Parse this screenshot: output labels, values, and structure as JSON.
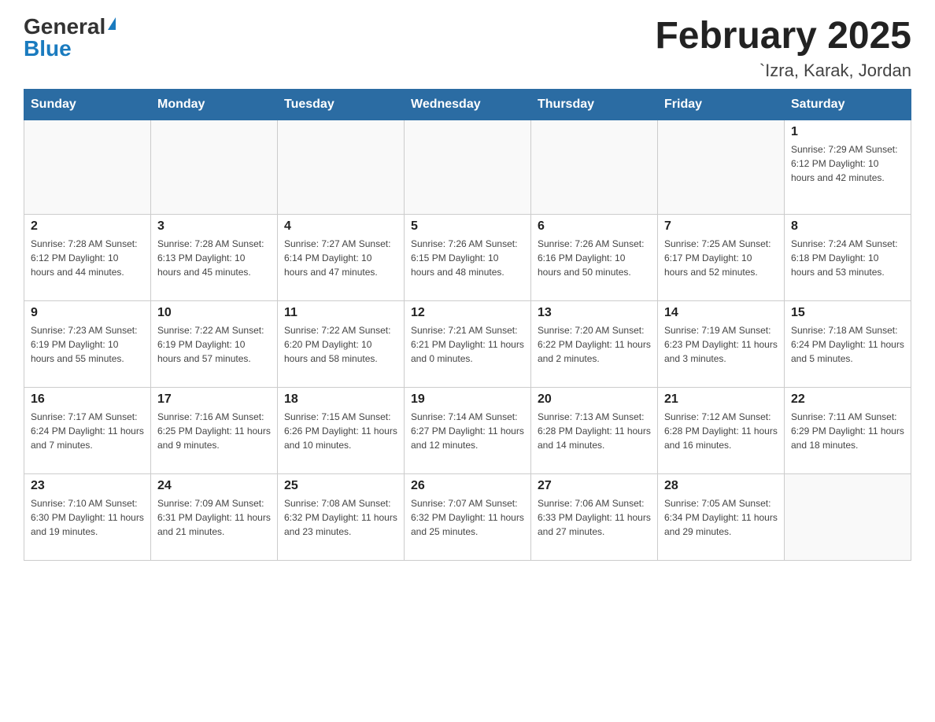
{
  "header": {
    "logo_general": "General",
    "logo_blue": "Blue",
    "month_title": "February 2025",
    "location": "`Izra, Karak, Jordan"
  },
  "days_of_week": [
    "Sunday",
    "Monday",
    "Tuesday",
    "Wednesday",
    "Thursday",
    "Friday",
    "Saturday"
  ],
  "weeks": [
    [
      {
        "day": "",
        "info": ""
      },
      {
        "day": "",
        "info": ""
      },
      {
        "day": "",
        "info": ""
      },
      {
        "day": "",
        "info": ""
      },
      {
        "day": "",
        "info": ""
      },
      {
        "day": "",
        "info": ""
      },
      {
        "day": "1",
        "info": "Sunrise: 7:29 AM\nSunset: 6:12 PM\nDaylight: 10 hours and 42 minutes."
      }
    ],
    [
      {
        "day": "2",
        "info": "Sunrise: 7:28 AM\nSunset: 6:12 PM\nDaylight: 10 hours and 44 minutes."
      },
      {
        "day": "3",
        "info": "Sunrise: 7:28 AM\nSunset: 6:13 PM\nDaylight: 10 hours and 45 minutes."
      },
      {
        "day": "4",
        "info": "Sunrise: 7:27 AM\nSunset: 6:14 PM\nDaylight: 10 hours and 47 minutes."
      },
      {
        "day": "5",
        "info": "Sunrise: 7:26 AM\nSunset: 6:15 PM\nDaylight: 10 hours and 48 minutes."
      },
      {
        "day": "6",
        "info": "Sunrise: 7:26 AM\nSunset: 6:16 PM\nDaylight: 10 hours and 50 minutes."
      },
      {
        "day": "7",
        "info": "Sunrise: 7:25 AM\nSunset: 6:17 PM\nDaylight: 10 hours and 52 minutes."
      },
      {
        "day": "8",
        "info": "Sunrise: 7:24 AM\nSunset: 6:18 PM\nDaylight: 10 hours and 53 minutes."
      }
    ],
    [
      {
        "day": "9",
        "info": "Sunrise: 7:23 AM\nSunset: 6:19 PM\nDaylight: 10 hours and 55 minutes."
      },
      {
        "day": "10",
        "info": "Sunrise: 7:22 AM\nSunset: 6:19 PM\nDaylight: 10 hours and 57 minutes."
      },
      {
        "day": "11",
        "info": "Sunrise: 7:22 AM\nSunset: 6:20 PM\nDaylight: 10 hours and 58 minutes."
      },
      {
        "day": "12",
        "info": "Sunrise: 7:21 AM\nSunset: 6:21 PM\nDaylight: 11 hours and 0 minutes."
      },
      {
        "day": "13",
        "info": "Sunrise: 7:20 AM\nSunset: 6:22 PM\nDaylight: 11 hours and 2 minutes."
      },
      {
        "day": "14",
        "info": "Sunrise: 7:19 AM\nSunset: 6:23 PM\nDaylight: 11 hours and 3 minutes."
      },
      {
        "day": "15",
        "info": "Sunrise: 7:18 AM\nSunset: 6:24 PM\nDaylight: 11 hours and 5 minutes."
      }
    ],
    [
      {
        "day": "16",
        "info": "Sunrise: 7:17 AM\nSunset: 6:24 PM\nDaylight: 11 hours and 7 minutes."
      },
      {
        "day": "17",
        "info": "Sunrise: 7:16 AM\nSunset: 6:25 PM\nDaylight: 11 hours and 9 minutes."
      },
      {
        "day": "18",
        "info": "Sunrise: 7:15 AM\nSunset: 6:26 PM\nDaylight: 11 hours and 10 minutes."
      },
      {
        "day": "19",
        "info": "Sunrise: 7:14 AM\nSunset: 6:27 PM\nDaylight: 11 hours and 12 minutes."
      },
      {
        "day": "20",
        "info": "Sunrise: 7:13 AM\nSunset: 6:28 PM\nDaylight: 11 hours and 14 minutes."
      },
      {
        "day": "21",
        "info": "Sunrise: 7:12 AM\nSunset: 6:28 PM\nDaylight: 11 hours and 16 minutes."
      },
      {
        "day": "22",
        "info": "Sunrise: 7:11 AM\nSunset: 6:29 PM\nDaylight: 11 hours and 18 minutes."
      }
    ],
    [
      {
        "day": "23",
        "info": "Sunrise: 7:10 AM\nSunset: 6:30 PM\nDaylight: 11 hours and 19 minutes."
      },
      {
        "day": "24",
        "info": "Sunrise: 7:09 AM\nSunset: 6:31 PM\nDaylight: 11 hours and 21 minutes."
      },
      {
        "day": "25",
        "info": "Sunrise: 7:08 AM\nSunset: 6:32 PM\nDaylight: 11 hours and 23 minutes."
      },
      {
        "day": "26",
        "info": "Sunrise: 7:07 AM\nSunset: 6:32 PM\nDaylight: 11 hours and 25 minutes."
      },
      {
        "day": "27",
        "info": "Sunrise: 7:06 AM\nSunset: 6:33 PM\nDaylight: 11 hours and 27 minutes."
      },
      {
        "day": "28",
        "info": "Sunrise: 7:05 AM\nSunset: 6:34 PM\nDaylight: 11 hours and 29 minutes."
      },
      {
        "day": "",
        "info": ""
      }
    ]
  ]
}
